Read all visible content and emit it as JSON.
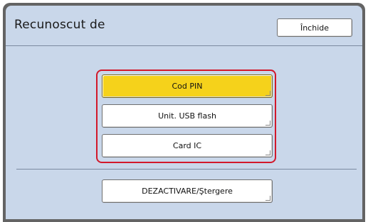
{
  "dialog": {
    "title": "Recunoscut de",
    "close_label": "Închide"
  },
  "options": [
    {
      "label": "Cod PIN",
      "selected": true
    },
    {
      "label": "Unit. USB flash",
      "selected": false
    },
    {
      "label": "Card IC",
      "selected": false
    }
  ],
  "disable_label": "DEZACTIVARE/Ştergere",
  "colors": {
    "panel_bg": "#c9d7ea",
    "selected_bg": "#f5d21b",
    "group_outline": "#d2182a"
  }
}
